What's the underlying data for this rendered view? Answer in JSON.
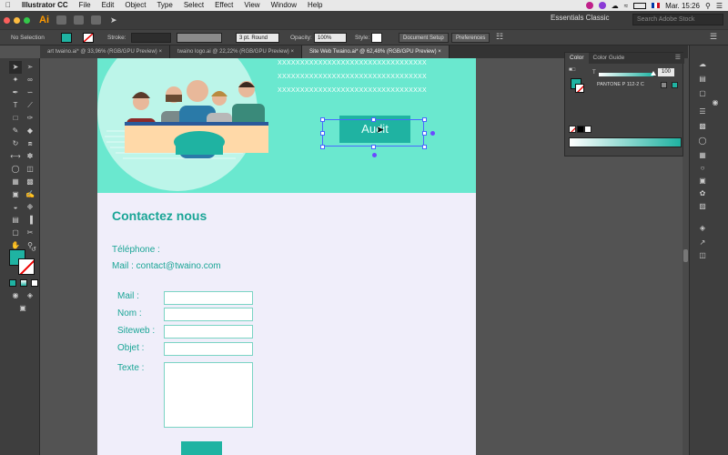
{
  "menubar": {
    "app_name": "Illustrator CC",
    "items": [
      "File",
      "Edit",
      "Object",
      "Type",
      "Select",
      "Effect",
      "View",
      "Window",
      "Help"
    ],
    "clock": "Mar. 15:26"
  },
  "appbar": {
    "app_logo": "Ai",
    "workspace": "Essentials Classic",
    "stock_search_placeholder": "Search Adobe Stock"
  },
  "control_bar": {
    "selection_label": "No Selection",
    "stroke_label": "Stroke:",
    "stroke_style": "3 pt. Round",
    "opacity_label": "Opacity:",
    "opacity_value": "100%",
    "style_label": "Style:",
    "document_setup": "Document Setup",
    "preferences": "Preferences"
  },
  "tabs": [
    {
      "label": "art twaino.ai* @ 33,96% (RGB/GPU Preview)",
      "active": false
    },
    {
      "label": "twaino logo.ai @ 22,22% (RGB/GPU Preview)",
      "active": false
    },
    {
      "label": "Site Web Twaino.ai* @ 62,48% (RGB/GPU Preview)",
      "active": true
    }
  ],
  "color_panel": {
    "tab_color": "Color",
    "tab_guide": "Color Guide",
    "channel_label": "T",
    "channel_value": "100",
    "pantone": "PANTONE P 112-2 C"
  },
  "artboard": {
    "x_lines": [
      "XXXXXXXXXXXXXXXXXXXXXXXXXXXXXXXXX",
      "XXXXXXXXXXXXXXXXXXXXXXXXXXXXXXXXX",
      "XXXXXXXXXXXXXXXXXXXXXXXXXXXXXXXXX"
    ],
    "audit_button": "Audit",
    "contact_title": "Contactez nous",
    "phone_label": "Téléphone :",
    "mail_line": "Mail : contact@twaino.com",
    "form_labels": {
      "mail": "Mail :",
      "nom": "Nom :",
      "siteweb": "Siteweb :",
      "objet": "Objet :",
      "texte": "Texte :"
    }
  },
  "colors": {
    "teal": "#1fb3a2",
    "mint": "#6ae8cf",
    "ai_orange": "#ff9a00"
  }
}
